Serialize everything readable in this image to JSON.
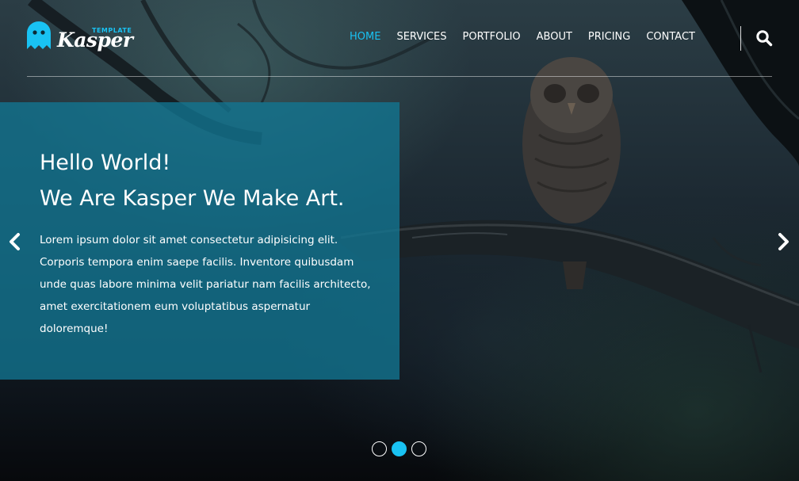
{
  "brand": {
    "name": "Kasper",
    "tagline": "TEMPLATE",
    "accent_color": "#19c2f3"
  },
  "nav": {
    "items": [
      {
        "label": "HOME",
        "active": true
      },
      {
        "label": "SERVICES",
        "active": false
      },
      {
        "label": "PORTFOLIO",
        "active": false
      },
      {
        "label": "ABOUT",
        "active": false
      },
      {
        "label": "PRICING",
        "active": false
      },
      {
        "label": "CONTACT",
        "active": false
      }
    ],
    "search_icon": "search-icon"
  },
  "hero": {
    "title_line1": "Hello World!",
    "title_line2": "We Are Kasper We Make Art.",
    "text": "Lorem ipsum dolor sit amet consectetur adipisicing elit. Corporis tempora enim saepe facilis. Inventore quibusdam unde quas labore minima velit pariatur nam facilis architecto, amet exercitationem eum voluptatibus aspernatur doloremque!",
    "box_color": "#127692"
  },
  "slider": {
    "prev_icon": "chevron-left-icon",
    "next_icon": "chevron-right-icon",
    "dots": 3,
    "active_dot": 2
  }
}
